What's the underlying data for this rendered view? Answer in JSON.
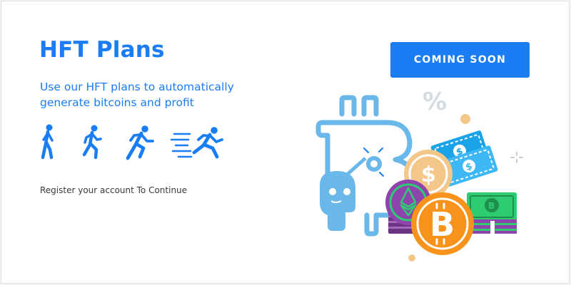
{
  "hero": {
    "title": "HFT Plans",
    "subtitle": "Use our HFT plans to automatically generate bitcoins and profit",
    "register_text": "Register your account To Continue",
    "cta_label": "COMING SOON"
  },
  "speed_icons": [
    "walking-person-icon",
    "jogging-person-icon",
    "running-person-icon",
    "sprinting-person-icon"
  ],
  "illustration": {
    "percent_symbol": "%",
    "dollar_symbol": "$",
    "bitcoin_symbol": "B"
  },
  "colors": {
    "brand_blue": "#1a7df4",
    "light_blue": "#6ab7ea",
    "bitcoin_orange": "#f7931a",
    "gold": "#f3c78a",
    "purple": "#8e44ad",
    "green": "#2ecc71"
  }
}
